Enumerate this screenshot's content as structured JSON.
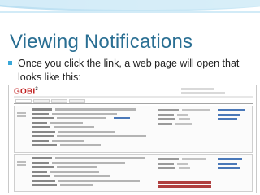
{
  "slide": {
    "title": "Viewing Notifications",
    "bullet_line1": "Once you click the link, a web page will open that",
    "bullet_line2": "looks like this:"
  },
  "logo": {
    "text_main": "GOBI",
    "superscript": "3"
  },
  "colors": {
    "title": "#2a6f93",
    "bullet_marker": "#3aa7d8",
    "link": "#4a78b8",
    "highlight": "#b04040"
  }
}
